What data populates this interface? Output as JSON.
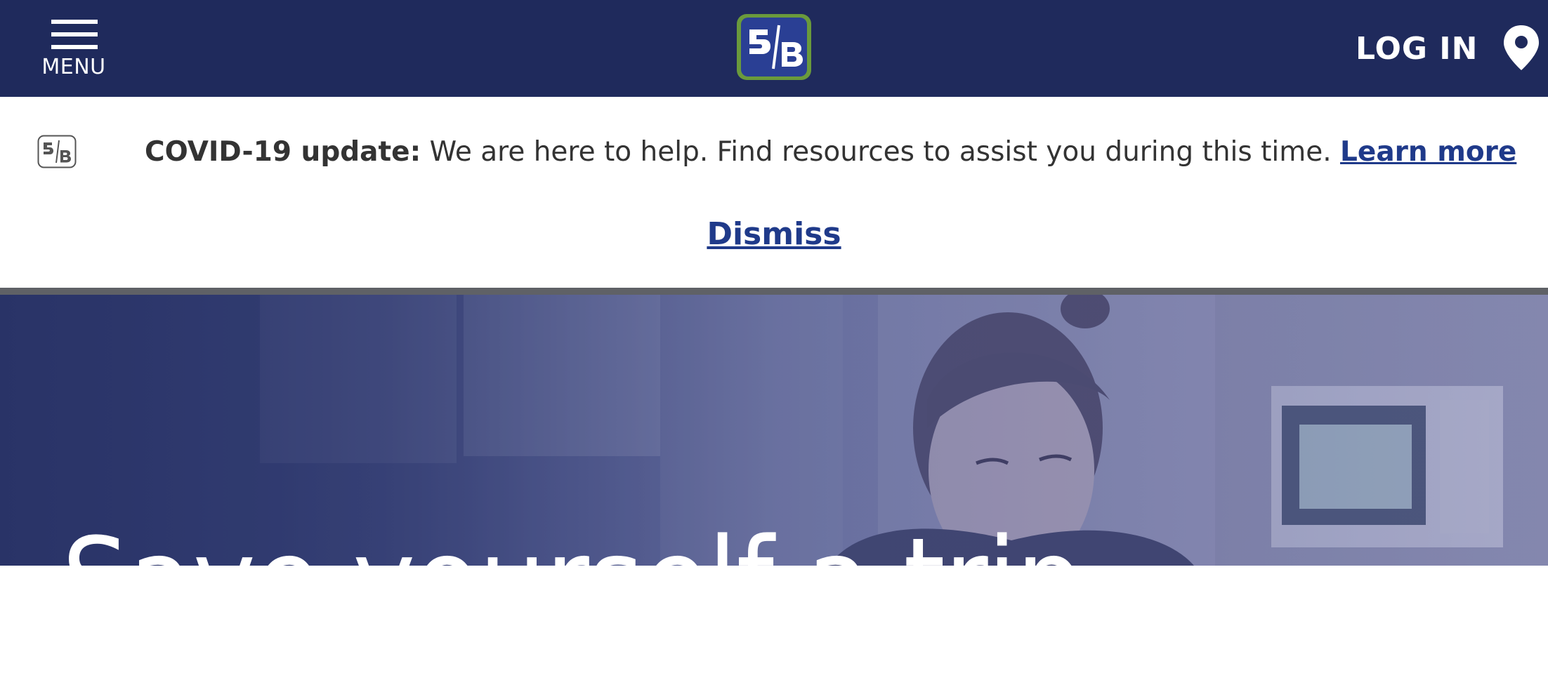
{
  "header": {
    "menu_label": "MENU",
    "login_label": "LOG IN",
    "logo_icon": "fifth-third-logo-icon",
    "location_icon": "location-pin-icon",
    "menu_icon": "hamburger-menu-icon",
    "colors": {
      "navbar": "#1f2a5c",
      "logo_border": "#6a9a3c",
      "logo_fill": "#2a3f94"
    }
  },
  "alert": {
    "logo_icon": "fifth-third-outline-icon",
    "title": "COVID-19 update:",
    "message": "We are here to help. Find resources to assist you during this time.",
    "link_label": "Learn more",
    "dismiss_label": "Dismiss",
    "link_color": "#1f3a8a"
  },
  "hero": {
    "title": "Save yourself a trip."
  }
}
